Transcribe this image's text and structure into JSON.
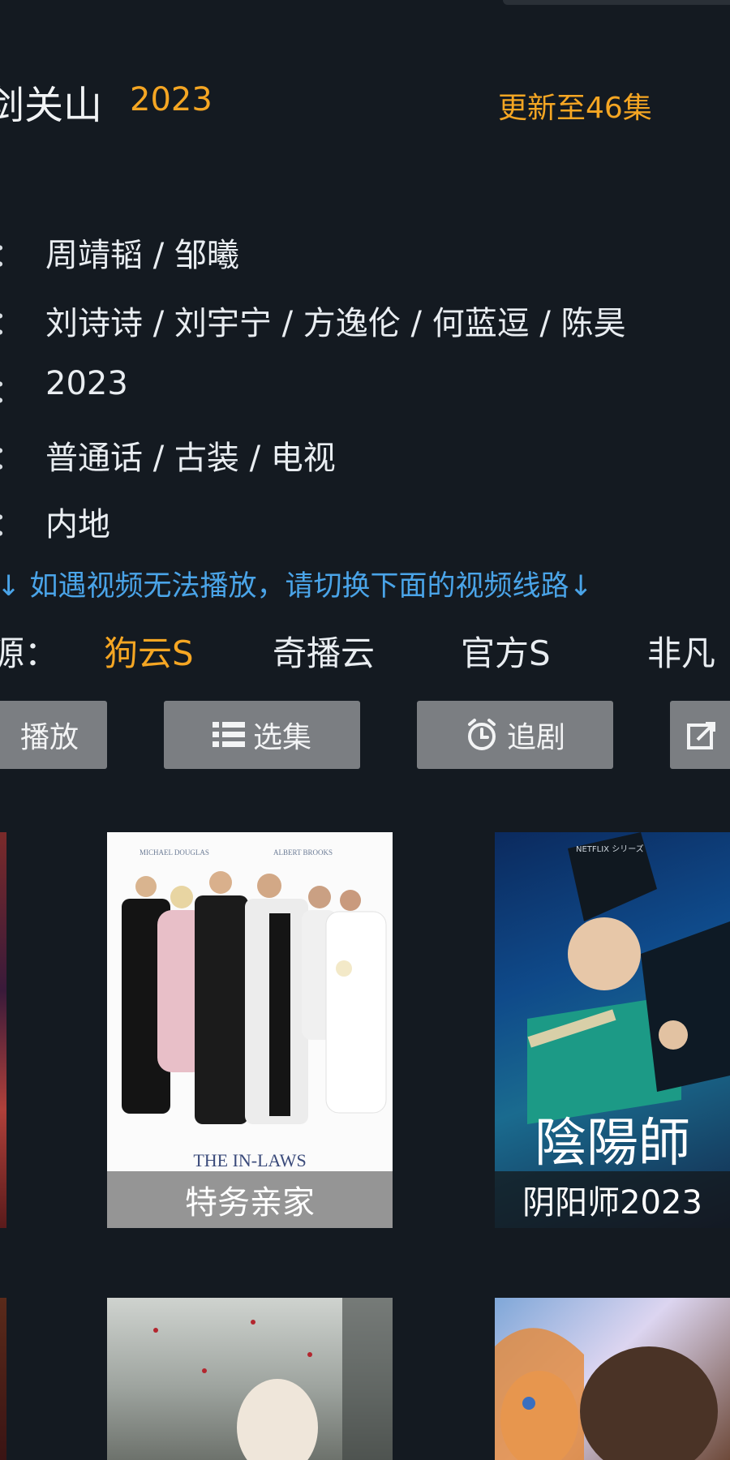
{
  "header": {
    "title": "剑关山",
    "year": "2023",
    "update_status": "更新至46集"
  },
  "info": {
    "colon": "：",
    "rows": [
      "周靖韬 / 邹曦",
      "刘诗诗 / 刘宇宁 / 方逸伦 / 何蓝逗 / 陈昊",
      "2023",
      "普通话 / 古装 / 电视",
      "内地"
    ]
  },
  "notice": "↓ 如遇视频无法播放，请切换下面的视频线路↓",
  "sources": {
    "label": "源：",
    "items": [
      "狗云S",
      "奇播云",
      "官方S",
      "非凡"
    ],
    "selected": "狗云S"
  },
  "actions": {
    "play": "播放",
    "episodes": "选集",
    "follow": "追剧",
    "share": ""
  },
  "posters": {
    "row1": [
      {
        "caption": ""
      },
      {
        "caption": "特务亲家",
        "top_text_left": "MICHAEL DOUGLAS",
        "top_text_right": "ALBERT BROOKS",
        "movie_title": "THE IN-LAWS"
      },
      {
        "caption": "阴阳师2023",
        "top_text": "NETFLIX シリーズ",
        "art_title": "陰陽師"
      }
    ],
    "row2": [
      {
        "caption": ""
      },
      {
        "caption": ""
      },
      {
        "caption": ""
      }
    ]
  },
  "colors": {
    "background": "#141a21",
    "accent": "#f5a623",
    "notice_blue": "#4aa4e8",
    "button_gray": "#7b7e82"
  }
}
